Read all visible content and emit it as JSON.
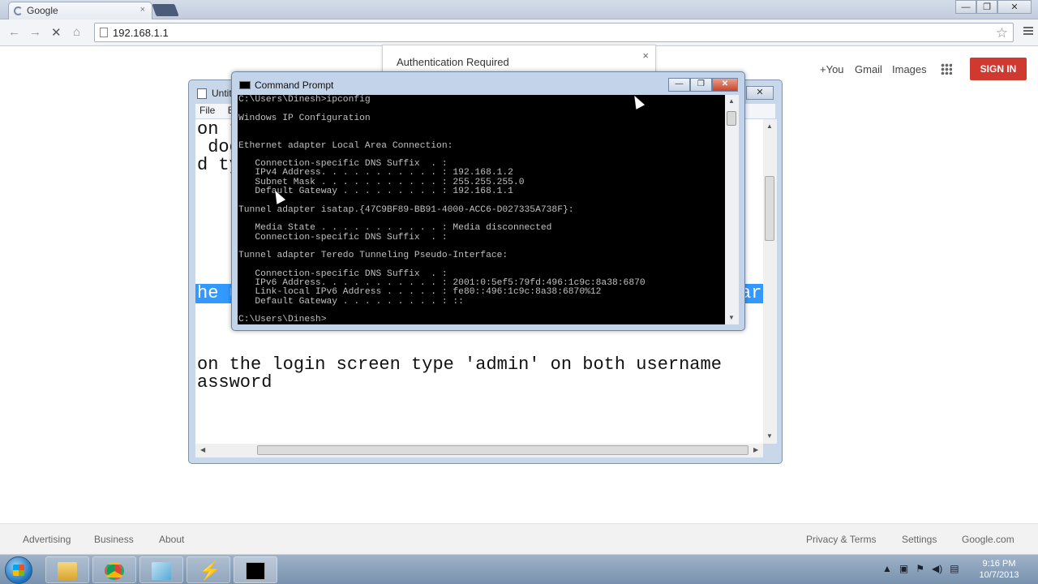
{
  "browser": {
    "tab_title": "Google",
    "tab_close": "×",
    "url": "192.168.1.1",
    "window_buttons": [
      "—",
      "❐",
      "✕"
    ]
  },
  "google": {
    "top_links": [
      "+You",
      "Gmail",
      "Images"
    ],
    "sign_in": "SIGN IN",
    "footer_left": [
      "Advertising",
      "Business",
      "About"
    ],
    "footer_right": [
      "Privacy & Terms",
      "Settings",
      "Google.com"
    ]
  },
  "auth_dialog": {
    "title": "Authentication Required",
    "close": "×"
  },
  "notepad": {
    "title": "Untit",
    "menu": [
      "File",
      "Ed"
    ],
    "close": "✕",
    "lines": [
      "on t",
      " doe",
      "d ty",
      "he u",
      "on the login screen type 'admin' on both username",
      "assword"
    ],
    "highlight_tail": "ar"
  },
  "cmd": {
    "title": "Command Prompt",
    "buttons": [
      "—",
      "❐",
      "✕"
    ],
    "lines": [
      "C:\\Users\\Dinesh>ipconfig",
      "",
      "Windows IP Configuration",
      "",
      "",
      "Ethernet adapter Local Area Connection:",
      "",
      "   Connection-specific DNS Suffix  . :",
      "   IPv4 Address. . . . . . . . . . . : 192.168.1.2",
      "   Subnet Mask . . . . . . . . . . . : 255.255.255.0",
      "   Default Gateway . . . . . . . . . : 192.168.1.1",
      "",
      "Tunnel adapter isatap.{47C9BF89-BB91-4000-ACC6-D027335A738F}:",
      "",
      "   Media State . . . . . . . . . . . : Media disconnected",
      "   Connection-specific DNS Suffix  . :",
      "",
      "Tunnel adapter Teredo Tunneling Pseudo-Interface:",
      "",
      "   Connection-specific DNS Suffix  . :",
      "   IPv6 Address. . . . . . . . . . . : 2001:0:5ef5:79fd:496:1c9c:8a38:6870",
      "   Link-local IPv6 Address . . . . . : fe80::496:1c9c:8a38:6870%12",
      "   Default Gateway . . . . . . . . . : ::",
      "",
      "C:\\Users\\Dinesh>"
    ]
  },
  "taskbar": {
    "apps": [
      "windows-explorer",
      "google-chrome",
      "notepad",
      "network-app",
      "command-prompt"
    ],
    "time": "9:16 PM",
    "date": "10/7/2013"
  },
  "colors": {
    "signin_bg": "#d0392f",
    "highlight": "#3399ff",
    "cmd_bg": "#000000"
  }
}
